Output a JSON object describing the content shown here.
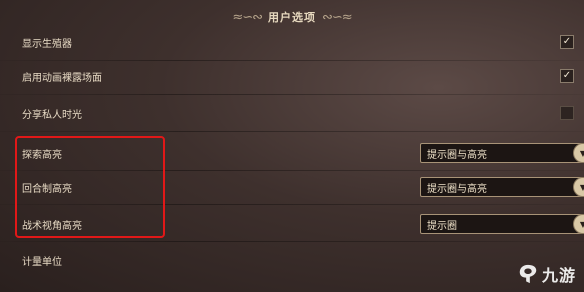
{
  "header": {
    "title": "用户选项",
    "flourish_left": "≈∽∾",
    "flourish_right": "∾∽≈"
  },
  "rows": [
    {
      "label": "显示生殖器",
      "control": "checkbox",
      "checked": true,
      "check_glyph": "✓"
    },
    {
      "label": "启用动画裸露场面",
      "control": "checkbox",
      "checked": true,
      "check_glyph": "✓"
    },
    {
      "label": "分享私人时光",
      "control": "checkbox",
      "checked": false,
      "check_glyph": ""
    },
    {
      "label": "探索高亮",
      "control": "dropdown",
      "value": "提示圈与高亮"
    },
    {
      "label": "回合制高亮",
      "control": "dropdown",
      "value": "提示圈与高亮"
    },
    {
      "label": "战术视角高亮",
      "control": "dropdown",
      "value": "提示圈"
    },
    {
      "label": "计量单位",
      "control": "none"
    }
  ],
  "dropdown_caret_glyph": "▼",
  "watermark": {
    "text": "九游",
    "logo_icon": "jiuyou-logo-icon"
  },
  "colors": {
    "highlight_box": "#e11818",
    "background": "#3e302d",
    "text": "#e7dac4"
  }
}
